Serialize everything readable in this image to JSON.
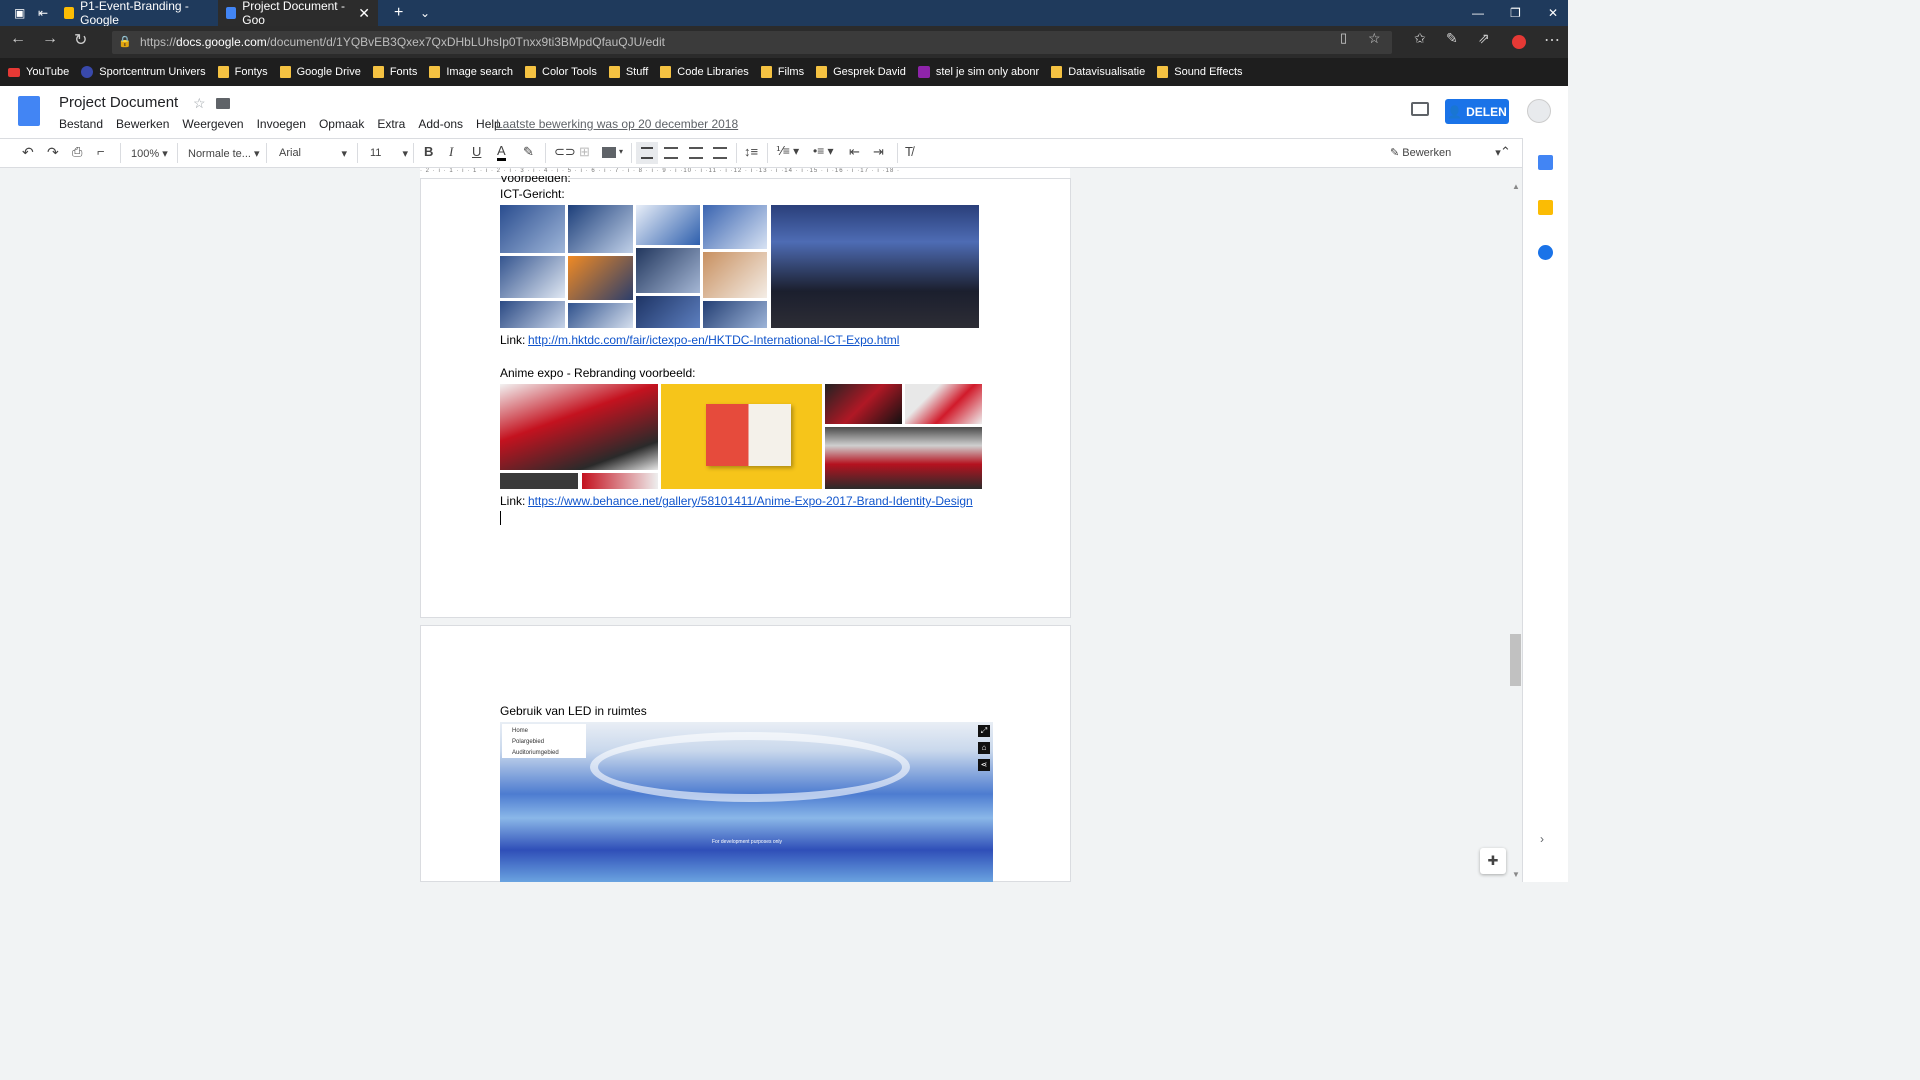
{
  "browser": {
    "tabs": [
      {
        "label": "P1-Event-Branding - Google",
        "active": false
      },
      {
        "label": "Project Document - Goo",
        "active": true
      }
    ],
    "url_prefix": "https://",
    "url_host": "docs.google.com",
    "url_path": "/document/d/1YQBvEB3Qxex7QxDHbLUhsIp0Tnxx9ti3BMpdQfauQJU/edit",
    "bookmarks": [
      "YouTube",
      "Sportcentrum Univers",
      "Fontys",
      "Google Drive",
      "Fonts",
      "Image search",
      "Color Tools",
      "Stuff",
      "Code Libraries",
      "Films",
      "Gesprek David",
      "stel je sim only abonr",
      "Datavisualisatie",
      "Sound Effects"
    ]
  },
  "doc": {
    "title": "Project Document",
    "menu": [
      "Bestand",
      "Bewerken",
      "Weergeven",
      "Invoegen",
      "Opmaak",
      "Extra",
      "Add-ons",
      "Help"
    ],
    "last_edit": "Laatste bewerking was op 20 december 2018",
    "share_label": "DELEN",
    "edit_mode": "Bewerken"
  },
  "toolbar": {
    "zoom": "100%",
    "style": "Normale te...",
    "font": "Arial",
    "size": "11"
  },
  "ruler_text": "· 2 · ı · 1 · ı · 1 · ı · 2 · ı · 3 · ı · 4 · ı · 5 · ı · 6 · ı · 7 · ı · 8 · ı · 9 · ı ·10 · ı ·11 · ı ·12 · ı ·13 · ı ·14 · ı ·15 · ı ·16 · ı ·17 · ı ·18 ·",
  "content": {
    "cut_line": "Voorbeelden:",
    "ict_heading": "ICT-Gericht:",
    "ict_link_label": "Link:",
    "ict_link": "http://m.hktdc.com/fair/ictexpo-en/HKTDC-International-ICT-Expo.html",
    "anime_heading": "Anime expo - Rebranding voorbeeld:",
    "anime_link_label": "Link:",
    "anime_link": "https://www.behance.net/gallery/58101411/Anime-Expo-2017-Brand-Identity-Design",
    "led_heading": "Gebruik van LED in ruimtes",
    "led_menu": [
      "Home",
      "Polargebied",
      "Auditoriumgebied"
    ],
    "led_caption": "For development purposes only"
  },
  "colors": {
    "accent": "#1a73e8",
    "link": "#1155cc",
    "tabbar": "#1f3a5c"
  }
}
